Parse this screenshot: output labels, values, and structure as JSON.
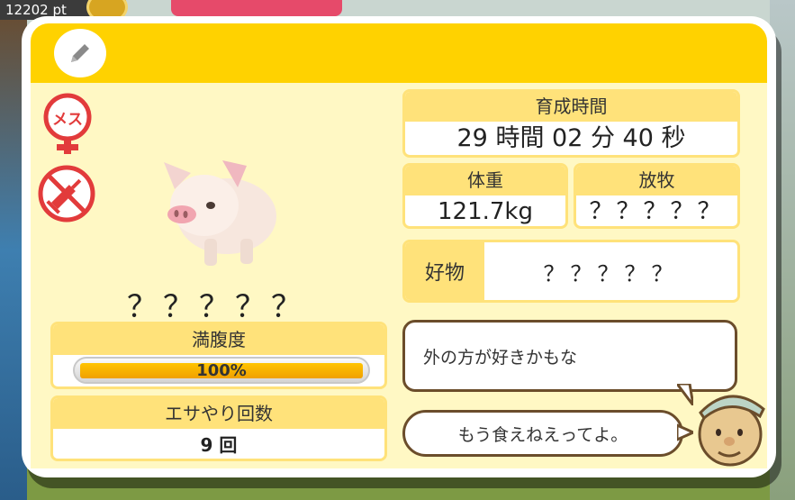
{
  "hud": {
    "points": "12202 pt"
  },
  "badges": {
    "sex": "メス"
  },
  "pig": {
    "name": "？？？？？"
  },
  "fullness": {
    "label": "満腹度",
    "value_text": "100%",
    "value": 1.0
  },
  "feeding": {
    "label": "エサやり回数",
    "value": "9 回"
  },
  "raise_time": {
    "label": "育成時間",
    "value": "29 時間 02 分 40 秒"
  },
  "weight": {
    "label": "体重",
    "value": "121.7kg"
  },
  "grazing": {
    "label": "放牧",
    "value": "？？？？？"
  },
  "favorite": {
    "label": "好物",
    "value": "？？？？？"
  },
  "dialog": {
    "line1": "外の方が好きかもな",
    "line2": "もう食えねえってよ。"
  },
  "icons": {
    "edit": "pencil-icon",
    "sex": "female-icon",
    "syringe": "no-injection-icon"
  },
  "colors": {
    "header_yellow": "#ffd200",
    "body_cream": "#fff8c4",
    "box_header": "#ffe27a",
    "bar_fill": "#f0a000",
    "badge_red": "#e23b3b",
    "bubble_border": "#6b4d2b"
  }
}
